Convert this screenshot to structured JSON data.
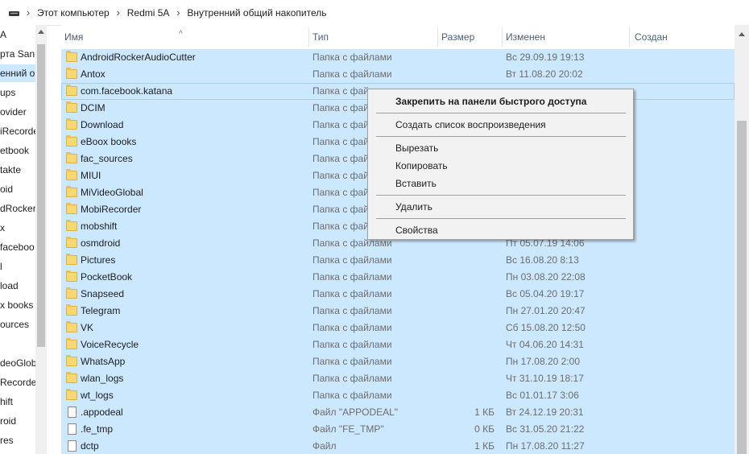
{
  "breadcrumb": [
    "Этот компьютер",
    "Redmi 5A",
    "Внутренний общий накопитель"
  ],
  "breadcrumb_separator": "›",
  "nav_items": [
    "A",
    "рта SanD",
    "енний об",
    "ups",
    "ovider",
    "iRecorde",
    "etbook",
    "takte",
    "oid",
    "dRocker",
    "x",
    "faceboo",
    "l",
    "load",
    "x books",
    "ources",
    "",
    "deoGlob",
    "Recorde",
    "hift",
    "roid",
    "res"
  ],
  "columns": {
    "name": "Имя",
    "type": "Тип",
    "size": "Размер",
    "modified": "Изменен",
    "created": "Создан"
  },
  "sort_indicator": "^",
  "rows": [
    {
      "name": "AndroidRockerAudioCutter",
      "type": "Папка с файлами",
      "size": "",
      "date": "Вс 29.09.19 19:13",
      "icon": "folder"
    },
    {
      "name": "Antox",
      "type": "Папка с файлами",
      "size": "",
      "date": "Вт 11.08.20 20:02",
      "icon": "folder"
    },
    {
      "name": "com.facebook.katana",
      "type": "Папка с фай",
      "size": "",
      "date": "",
      "icon": "folder"
    },
    {
      "name": "DCIM",
      "type": "Папка с фай",
      "size": "",
      "date": "",
      "icon": "folder"
    },
    {
      "name": "Download",
      "type": "Папка с фай",
      "size": "",
      "date": "",
      "icon": "folder"
    },
    {
      "name": "eBoox books",
      "type": "Папка с фай",
      "size": "",
      "date": "",
      "icon": "folder"
    },
    {
      "name": "fac_sources",
      "type": "Папка с фай",
      "size": "",
      "date": "",
      "icon": "folder"
    },
    {
      "name": "MIUI",
      "type": "Папка с фай",
      "size": "",
      "date": "",
      "icon": "folder"
    },
    {
      "name": "MiVideoGlobal",
      "type": "Папка с фай",
      "size": "",
      "date": "",
      "icon": "folder"
    },
    {
      "name": "MobiRecorder",
      "type": "Папка с фай",
      "size": "",
      "date": "",
      "icon": "folder"
    },
    {
      "name": "mobshift",
      "type": "Папка с фай",
      "size": "",
      "date": "",
      "icon": "folder"
    },
    {
      "name": "osmdroid",
      "type": "Папка с файлами",
      "size": "",
      "date": "Пт 05.07.19 14:06",
      "icon": "folder"
    },
    {
      "name": "Pictures",
      "type": "Папка с файлами",
      "size": "",
      "date": "Вс 16.08.20 8:13",
      "icon": "folder"
    },
    {
      "name": "PocketBook",
      "type": "Папка с файлами",
      "size": "",
      "date": "Пн 03.08.20 22:08",
      "icon": "folder"
    },
    {
      "name": "Snapseed",
      "type": "Папка с файлами",
      "size": "",
      "date": "Вс 05.04.20 19:17",
      "icon": "folder"
    },
    {
      "name": "Telegram",
      "type": "Папка с файлами",
      "size": "",
      "date": "Пн 27.01.20 20:47",
      "icon": "folder"
    },
    {
      "name": "VK",
      "type": "Папка с файлами",
      "size": "",
      "date": "Сб 15.08.20 12:50",
      "icon": "folder"
    },
    {
      "name": "VoiceRecycle",
      "type": "Папка с файлами",
      "size": "",
      "date": "Чт 04.06.20 14:31",
      "icon": "folder"
    },
    {
      "name": "WhatsApp",
      "type": "Папка с файлами",
      "size": "",
      "date": "Пн 17.08.20 2:00",
      "icon": "folder"
    },
    {
      "name": "wlan_logs",
      "type": "Папка с файлами",
      "size": "",
      "date": "Чт 31.10.19 18:17",
      "icon": "folder"
    },
    {
      "name": "wt_logs",
      "type": "Папка с файлами",
      "size": "",
      "date": "Вс 01.01.17 3:06",
      "icon": "folder"
    },
    {
      "name": ".appodeal",
      "type": "Файл \"APPODEAL\"",
      "size": "1 КБ",
      "date": "Вт 24.12.19 20:31",
      "icon": "file"
    },
    {
      "name": ".fe_tmp",
      "type": "Файл \"FE_TMP\"",
      "size": "0 КБ",
      "date": "Вс 31.05.20 21:22",
      "icon": "file"
    },
    {
      "name": "dctp",
      "type": "Файл",
      "size": "1 КБ",
      "date": "Пн 17.08.20 11:27",
      "icon": "file"
    }
  ],
  "context_menu": {
    "pin": "Закрепить на панели быстрого доступа",
    "playlist": "Создать список воспроизведения",
    "cut": "Вырезать",
    "copy": "Копировать",
    "paste": "Вставить",
    "delete": "Удалить",
    "properties": "Свойства"
  },
  "colors": {
    "selection": "#cce8ff",
    "header_text": "#4c607a",
    "folder": "#f8d775"
  }
}
